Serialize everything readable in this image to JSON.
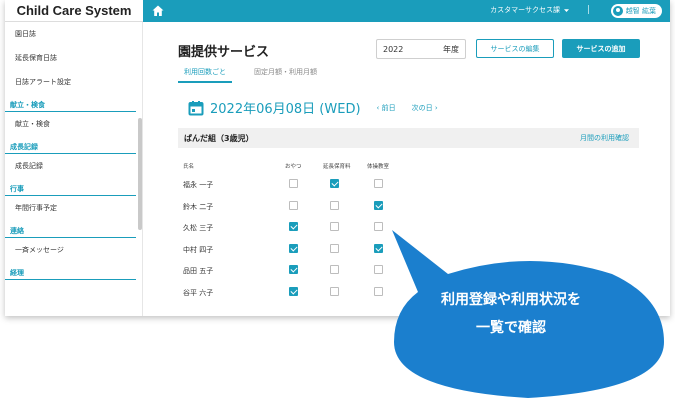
{
  "app": {
    "title": "Child Care System"
  },
  "navbar": {
    "customer": "カスタマーサクセス課",
    "separator": "|",
    "user": "越智 紘葉"
  },
  "sidebar": {
    "items_top": [
      "園日誌",
      "延長保育日誌",
      "日誌アラート設定"
    ],
    "sections": [
      {
        "heading": "献立・検食",
        "items": [
          "献立・検食"
        ]
      },
      {
        "heading": "成長記録",
        "items": [
          "成長記録"
        ]
      },
      {
        "heading": "行事",
        "items": [
          "年間行事予定"
        ]
      },
      {
        "heading": "連絡",
        "items": [
          "一斉メッセージ"
        ]
      },
      {
        "heading": "経理",
        "items": []
      }
    ]
  },
  "main": {
    "title": "園提供サービス",
    "year": {
      "value": "2022",
      "suffix": "年度"
    },
    "edit_button": "サービスの編集",
    "add_button": "サービスの追加",
    "tabs": [
      {
        "label": "利用回数ごと",
        "active": true
      },
      {
        "label": "固定月額・利用月額",
        "active": false
      }
    ],
    "date": "2022年06月08日 (WED)",
    "prev_day": "前日",
    "next_day": "次の日",
    "group": {
      "name": "ぱんだ組（3歳児）",
      "monthly_link": "月間の利用確認"
    },
    "columns": [
      "氏名",
      "おやつ",
      "延長保育料",
      "体操教室"
    ],
    "rows": [
      {
        "name": "福永 一子",
        "checks": [
          false,
          true,
          false
        ]
      },
      {
        "name": "鈴木 二子",
        "checks": [
          false,
          false,
          true
        ]
      },
      {
        "name": "久松 三子",
        "checks": [
          true,
          false,
          false
        ]
      },
      {
        "name": "中村 四子",
        "checks": [
          true,
          false,
          true
        ]
      },
      {
        "name": "品田 五子",
        "checks": [
          true,
          false,
          false
        ]
      },
      {
        "name": "谷平 六子",
        "checks": [
          true,
          false,
          false
        ]
      }
    ]
  },
  "callout": {
    "line1": "利用登録や利用状況を",
    "line2": "一覧で確認"
  },
  "colors": {
    "accent": "#1a9dbb",
    "callout": "#1b7fce"
  },
  "icons": [
    "home-icon",
    "chevron-down-icon",
    "user-icon",
    "calendar-icon",
    "chevron-left-icon",
    "chevron-right-icon",
    "check-icon"
  ]
}
